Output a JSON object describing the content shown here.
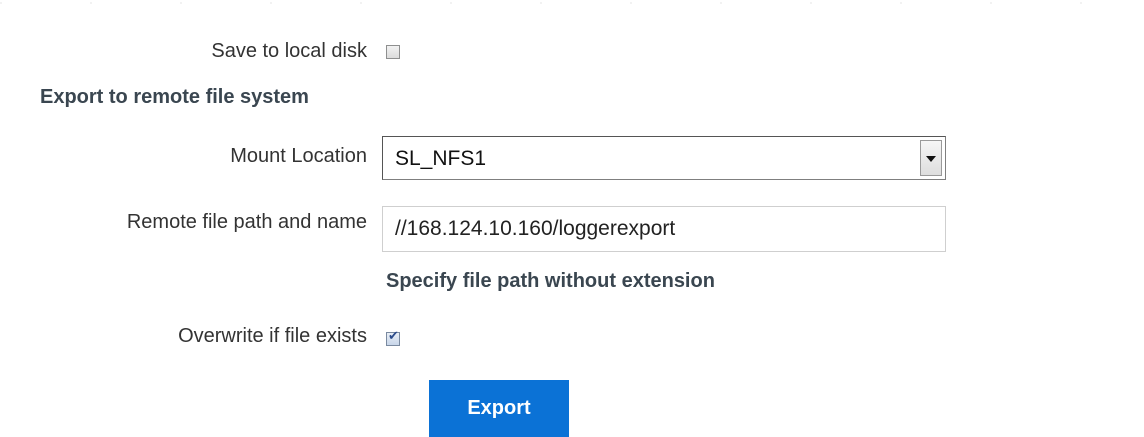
{
  "form": {
    "save_local_label": "Save to local disk",
    "save_local_checked": false,
    "remote_section_heading": "Export to remote file system",
    "mount_location_label": "Mount Location",
    "mount_location_value": "SL_NFS1",
    "remote_path_label": "Remote file path and name",
    "remote_path_value": "//168.124.10.160/loggerexport",
    "remote_path_hint": "Specify file path without extension",
    "overwrite_label": "Overwrite if file exists",
    "overwrite_checked": true,
    "export_button_label": "Export"
  },
  "icons": {
    "checkmark": "✔",
    "dropdown_arrow": "chevron-down-icon"
  },
  "colors": {
    "button_bg": "#0b72d6",
    "heading_text": "#3a4650"
  }
}
